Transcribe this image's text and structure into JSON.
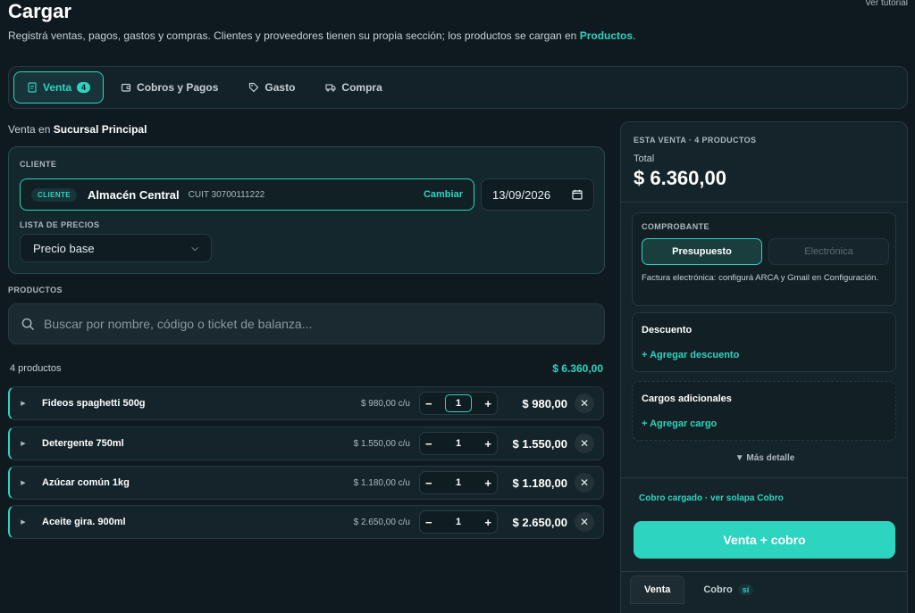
{
  "header": {
    "title": "Cargar",
    "tutorial_link": "Ver tutorial",
    "subtitle_text": "Registrá ventas, pagos, gastos y compras. Clientes y proveedores tienen su propia sección; los productos se cargan en",
    "subtitle_link": "Productos",
    "subtitle_end": "."
  },
  "tabs": [
    {
      "label": "Venta",
      "badge": "4",
      "icon": "receipt-icon"
    },
    {
      "label": "Cobros y Pagos",
      "icon": "wallet-icon"
    },
    {
      "label": "Gasto",
      "icon": "tag-icon"
    },
    {
      "label": "Compra",
      "icon": "truck-icon"
    }
  ],
  "branch": {
    "prefix": "Venta en",
    "name": "Sucursal Principal"
  },
  "client": {
    "section_label": "CLIENTE",
    "tag": "CLIENTE",
    "name": "Almacén Central",
    "cuit": "CUIT 30700111222",
    "change_label": "Cambiar",
    "date": "13/09/2026",
    "price_list_label": "LISTA DE PRECIOS",
    "price_list_value": "Precio base"
  },
  "products": {
    "section_label": "PRODUCTOS",
    "search_placeholder": "Buscar por nombre, código o ticket de balanza...",
    "count_label": "4 productos",
    "total": "$ 6.360,00",
    "items": [
      {
        "name": "Fideos spaghetti 500g",
        "unit_price": "$ 980,00 c/u",
        "qty": "1",
        "subtotal": "$ 980,00"
      },
      {
        "name": "Detergente 750ml",
        "unit_price": "$ 1.550,00 c/u",
        "qty": "1",
        "subtotal": "$ 1.550,00"
      },
      {
        "name": "Azúcar común 1kg",
        "unit_price": "$ 1.180,00 c/u",
        "qty": "1",
        "subtotal": "$ 1.180,00"
      },
      {
        "name": "Aceite gira. 900ml",
        "unit_price": "$ 2.650,00 c/u",
        "qty": "1",
        "subtotal": "$ 2.650,00"
      }
    ]
  },
  "summary": {
    "heading": "ESTA VENTA · 4 PRODUCTOS",
    "total_label": "Total",
    "total": "$ 6.360,00",
    "comprobante_label": "COMPROBANTE",
    "comprobante_options": [
      "Presupuesto",
      "Electrónica"
    ],
    "comprobante_note": "Factura electrónica: configurá ARCA y Gmail en Configuración.",
    "discount_title": "Descuento",
    "discount_action": "+ Agregar descuento",
    "charges_title": "Cargos adicionales",
    "charges_action": "+ Agregar cargo",
    "more_detail": "▼ Más detalle",
    "cobro_status": "Cobro cargado · ver solapa Cobro",
    "main_button": "Venta + cobro",
    "bottom_tabs": [
      {
        "label": "Venta"
      },
      {
        "label": "Cobro",
        "badge": "sí"
      }
    ]
  },
  "colors": {
    "accent": "#2dd4bf",
    "background": "#0f1a20"
  }
}
